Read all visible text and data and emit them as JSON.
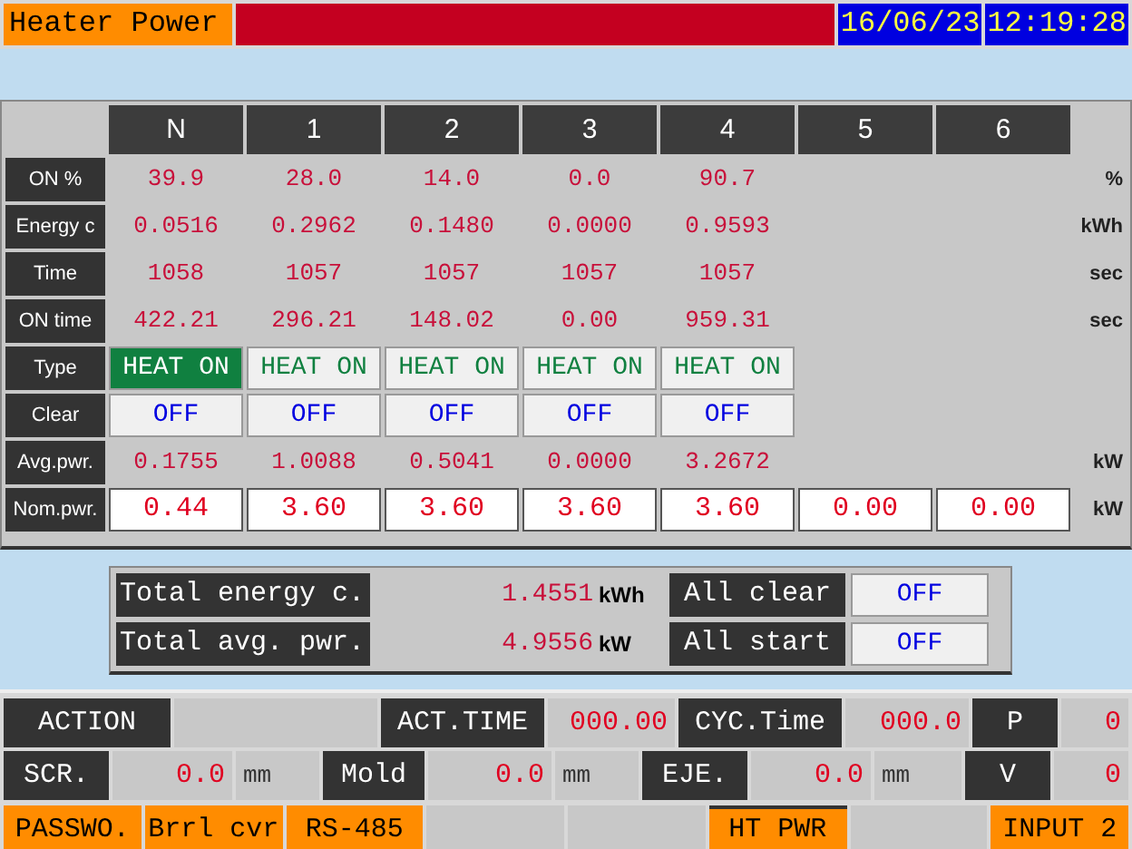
{
  "header": {
    "title": "Heater Power",
    "date": "16/06/23",
    "time": "12:19:28"
  },
  "table": {
    "columns": [
      "N",
      "1",
      "2",
      "3",
      "4",
      "5",
      "6"
    ],
    "rows": [
      {
        "label": "ON %",
        "kind": "value",
        "cells": [
          "39.9",
          "28.0",
          "14.0",
          "0.0",
          "90.7"
        ],
        "unit": "%"
      },
      {
        "label": "Energy c",
        "kind": "value",
        "cells": [
          "0.0516",
          "0.2962",
          "0.1480",
          "0.0000",
          "0.9593"
        ],
        "unit": "kWh"
      },
      {
        "label": "Time",
        "kind": "value",
        "cells": [
          "1058",
          "1057",
          "1057",
          "1057",
          "1057"
        ],
        "unit": "sec"
      },
      {
        "label": "ON time",
        "kind": "value",
        "cells": [
          "422.21",
          "296.21",
          "148.02",
          "0.00",
          "959.31"
        ],
        "unit": "sec"
      },
      {
        "label": "Type",
        "kind": "type",
        "cells": [
          {
            "text": "HEAT ON",
            "selected": true
          },
          {
            "text": "HEAT ON",
            "selected": false
          },
          {
            "text": "HEAT ON",
            "selected": false
          },
          {
            "text": "HEAT ON",
            "selected": false
          },
          {
            "text": "HEAT ON",
            "selected": false
          }
        ]
      },
      {
        "label": "Clear",
        "kind": "toggle",
        "cells": [
          "OFF",
          "OFF",
          "OFF",
          "OFF",
          "OFF"
        ]
      },
      {
        "label": "Avg.pwr.",
        "kind": "value",
        "cells": [
          "0.1755",
          "1.0088",
          "0.5041",
          "0.0000",
          "3.2672"
        ],
        "unit": "kW"
      },
      {
        "label": "Nom.pwr.",
        "kind": "input",
        "cells": [
          "0.44",
          "3.60",
          "3.60",
          "3.60",
          "3.60",
          "0.00",
          "0.00"
        ],
        "unit": "kW"
      }
    ]
  },
  "totals": [
    {
      "label": "Total energy c.",
      "value": "1.4551",
      "unit": "kWh",
      "button_label": "All clear",
      "button_value": "OFF"
    },
    {
      "label": "Total avg. pwr.",
      "value": "4.9556",
      "unit": "kW",
      "button_label": "All start",
      "button_value": "OFF"
    }
  ],
  "status_rows": [
    [
      {
        "kind": "label",
        "text": "ACTION"
      },
      {
        "kind": "blank"
      },
      {
        "kind": "label",
        "text": "ACT.TIME"
      },
      {
        "kind": "value",
        "text": "000.00"
      },
      {
        "kind": "label",
        "text": "CYC.Time"
      },
      {
        "kind": "value",
        "text": "000.0"
      },
      {
        "kind": "label",
        "text": "P"
      },
      {
        "kind": "value",
        "text": "0"
      }
    ],
    [
      {
        "kind": "label",
        "text": "SCR."
      },
      {
        "kind": "value",
        "text": "0.0"
      },
      {
        "kind": "unit",
        "text": "mm"
      },
      {
        "kind": "label",
        "text": "Mold"
      },
      {
        "kind": "value",
        "text": "0.0"
      },
      {
        "kind": "unit",
        "text": "mm"
      },
      {
        "kind": "label",
        "text": "EJE."
      },
      {
        "kind": "value",
        "text": "0.0"
      },
      {
        "kind": "unit",
        "text": "mm"
      },
      {
        "kind": "label",
        "text": "V"
      },
      {
        "kind": "value",
        "text": "0"
      }
    ]
  ],
  "function_keys": [
    {
      "kind": "key",
      "label": "PASSWO.",
      "selected": false
    },
    {
      "kind": "key",
      "label": "Brrl cvr",
      "selected": false
    },
    {
      "kind": "key",
      "label": "RS-485",
      "selected": false
    },
    {
      "kind": "blank"
    },
    {
      "kind": "blank"
    },
    {
      "kind": "key",
      "label": "HT PWR",
      "selected": true
    },
    {
      "kind": "blank"
    },
    {
      "kind": "key",
      "label": "INPUT 2",
      "selected": false
    }
  ]
}
